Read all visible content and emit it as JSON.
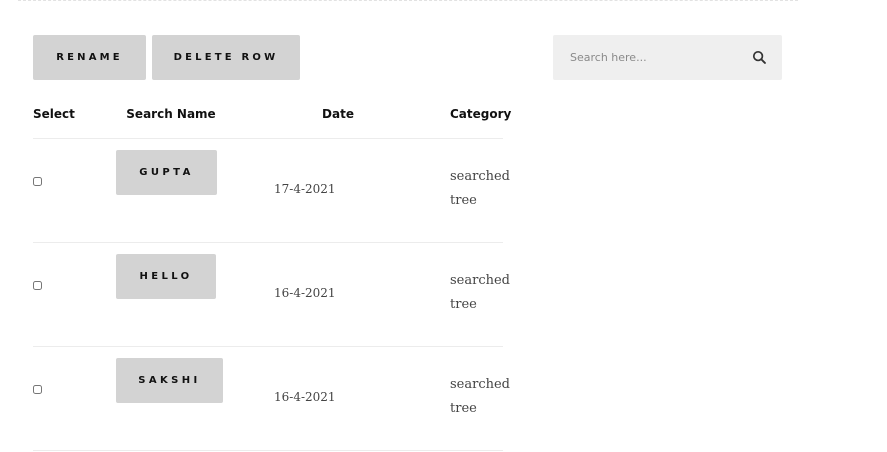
{
  "toolbar": {
    "rename_label": "RENAME",
    "delete_label": "DELETE ROW"
  },
  "search": {
    "placeholder": "Search here..."
  },
  "table": {
    "headers": [
      "Select",
      "Search Name",
      "Date",
      "Category"
    ],
    "rows": [
      {
        "name": "GUPTA",
        "date": "17-4-2021",
        "category": "searched tree"
      },
      {
        "name": "HELLO",
        "date": "16-4-2021",
        "category": "searched tree"
      },
      {
        "name": "SAKSHI",
        "date": "16-4-2021",
        "category": "searched tree"
      }
    ]
  }
}
